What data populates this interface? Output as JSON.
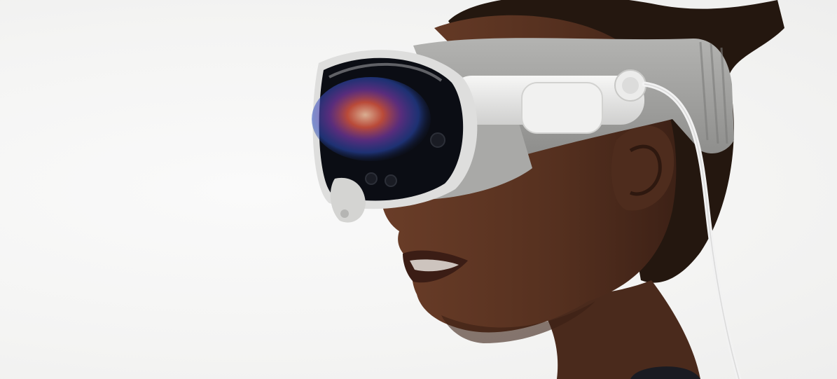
{
  "scene": {
    "background_color": "#f5f5f4",
    "subject": "person-wearing-headset",
    "colors": {
      "skin": "#5a3322",
      "skin_shadow": "#3a1f14",
      "hair": "#24170f",
      "headset_glass": "#0b0d14",
      "headset_frame": "#e9e9e8",
      "headband": "#9a9a98",
      "cable": "#f2f2f2",
      "display_glow_red": "#e0443b",
      "display_glow_blue": "#3b6fe0"
    }
  }
}
